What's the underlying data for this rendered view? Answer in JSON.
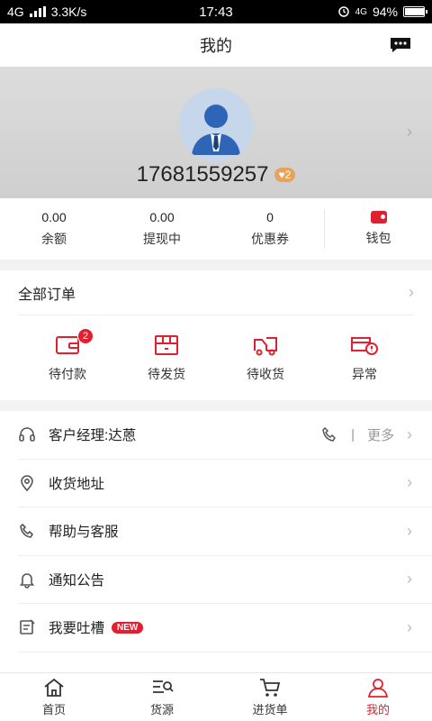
{
  "status_bar": {
    "network": "4G",
    "speed": "3.3K/s",
    "time": "17:43",
    "network_right": "4G",
    "battery": "94%",
    "battery_level": 0.94
  },
  "header": {
    "title": "我的"
  },
  "profile": {
    "phone": "17681559257",
    "vip_level": "2"
  },
  "assets": [
    {
      "value": "0.00",
      "label": "余额"
    },
    {
      "value": "0.00",
      "label": "提现中"
    },
    {
      "value": "0",
      "label": "优惠券"
    }
  ],
  "wallet": {
    "label": "钱包"
  },
  "orders": {
    "title": "全部订单",
    "items": [
      {
        "label": "待付款",
        "icon": "wallet-icon",
        "badge": "2"
      },
      {
        "label": "待发货",
        "icon": "package-icon"
      },
      {
        "label": "待收货",
        "icon": "truck-icon"
      },
      {
        "label": "异常",
        "icon": "warning-truck-icon"
      }
    ]
  },
  "menu": {
    "items": [
      {
        "label": "客户经理:达蒽",
        "icon": "headset-icon",
        "extra": "更多",
        "separator": "|"
      },
      {
        "label": "收货地址",
        "icon": "location-icon"
      },
      {
        "label": "帮助与客服",
        "icon": "phone-icon"
      },
      {
        "label": "通知公告",
        "icon": "bell-icon"
      },
      {
        "label": "我要吐槽",
        "icon": "edit-icon",
        "badge": "NEW"
      }
    ]
  },
  "tabbar": {
    "items": [
      {
        "label": "首页",
        "icon": "home-icon"
      },
      {
        "label": "货源",
        "icon": "search-list-icon"
      },
      {
        "label": "进货单",
        "icon": "cart-icon"
      },
      {
        "label": "我的",
        "icon": "user-icon",
        "active": true
      }
    ]
  },
  "colors": {
    "accent": "#e0202f"
  }
}
